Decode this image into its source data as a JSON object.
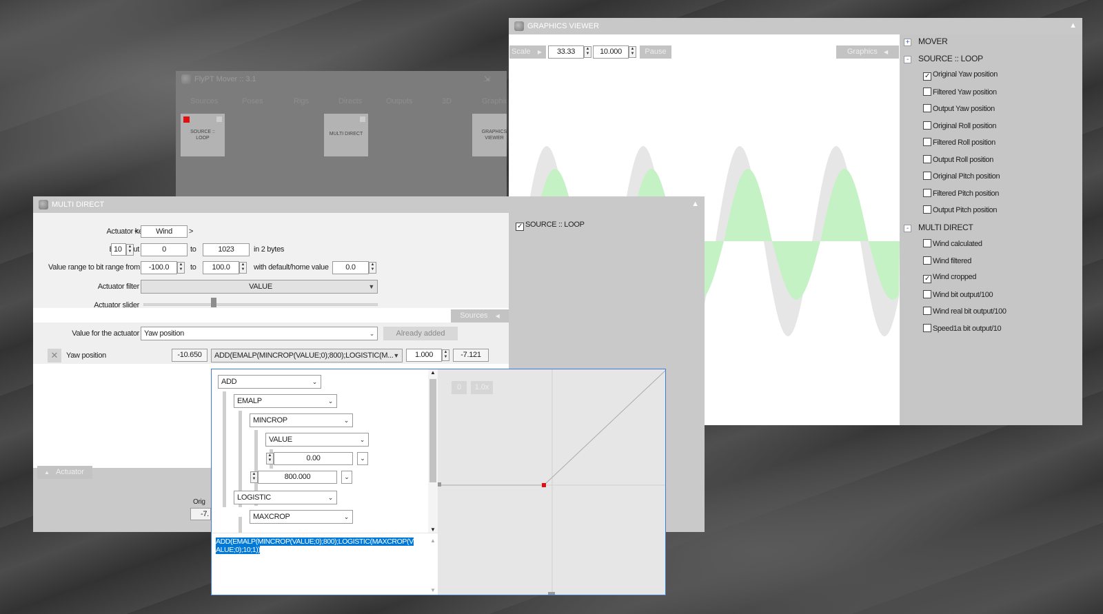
{
  "mover": {
    "title": "FlyPT Mover :: 3.1",
    "tabs": [
      "Sources",
      "Poses",
      "Rigs",
      "Directs",
      "Outputs",
      "3D",
      "Graphics"
    ],
    "tiles": [
      "SOURCE :: LOOP",
      "MULTI DIRECT",
      "GRAPHICS VIEWER"
    ]
  },
  "graphics": {
    "title": "GRAPHICS VIEWER",
    "scale_label": "Scale",
    "scale_value": "33.33",
    "second_value": "10.000",
    "pause_label": "Pause",
    "graphics_label": "Graphics",
    "legend": [
      {
        "kind": "head",
        "sign": "+",
        "label": "MOVER"
      },
      {
        "kind": "head",
        "sign": "-",
        "label": "SOURCE :: LOOP"
      },
      {
        "kind": "item",
        "checked": true,
        "label": "Original Yaw position"
      },
      {
        "kind": "item",
        "checked": false,
        "label": "Filtered Yaw position"
      },
      {
        "kind": "item",
        "checked": false,
        "label": "Output Yaw position"
      },
      {
        "kind": "item",
        "checked": false,
        "label": "Original Roll position"
      },
      {
        "kind": "item",
        "checked": false,
        "label": "Filtered Roll position"
      },
      {
        "kind": "item",
        "checked": false,
        "label": "Output Roll position"
      },
      {
        "kind": "item",
        "checked": false,
        "label": "Original Pitch position"
      },
      {
        "kind": "item",
        "checked": false,
        "label": "Filtered Pitch position"
      },
      {
        "kind": "item",
        "checked": false,
        "label": "Output Pitch position"
      },
      {
        "kind": "head",
        "sign": "-",
        "label": "MULTI DIRECT"
      },
      {
        "kind": "item",
        "checked": false,
        "label": "Wind calculated"
      },
      {
        "kind": "item",
        "checked": false,
        "label": "Wind filtered"
      },
      {
        "kind": "item",
        "checked": true,
        "label": "Wind cropped"
      },
      {
        "kind": "item",
        "checked": false,
        "label": "Wind bit output/100"
      },
      {
        "kind": "item",
        "checked": false,
        "label": "Wind real bit output/100"
      },
      {
        "kind": "item",
        "checked": false,
        "label": "Speed1a bit output/10"
      }
    ]
  },
  "multi": {
    "title": "MULTI DIRECT",
    "actuator_key_label": "Actuator key",
    "actuator_key_prev": "<",
    "actuator_key_value": "Wind",
    "actuator_key_next": ">",
    "bit_output_label": "Bit output",
    "bit_output_value": "10",
    "bit_from": "0",
    "to1": "to",
    "bit_to": "1023",
    "bytes_text": "in 2 bytes",
    "range_label": "Value range to bit range from",
    "range_from": "-100.0",
    "to2": "to",
    "range_to": "100.0",
    "default_label": "with default/home value",
    "default_value": "0.0",
    "filter_label": "Actuator filter",
    "filter_value": "VALUE",
    "slider_label": "Actuator slider",
    "slider_level": 0.3,
    "sources_btn": "Sources",
    "value_label": "Value for the actuator",
    "value_select": "Yaw position",
    "already_btn": "Already added",
    "row_name": "Yaw position",
    "row_value": "-10.650",
    "row_formula": "ADD(EMALP(MINCROP(VALUE;0);800);LOGISTIC(M...",
    "row_factor": "1.000",
    "row_result": "-7.121",
    "actuator_tab": "Actuator",
    "orig_text": "Orig",
    "orig_value": "-7.",
    "source_checkbox": "SOURCE :: LOOP"
  },
  "editor": {
    "tree": [
      {
        "label": "ADD",
        "kind": "dd"
      },
      {
        "label": "EMALP",
        "kind": "dd"
      },
      {
        "label": "MINCROP",
        "kind": "dd"
      },
      {
        "label": "VALUE",
        "kind": "dd"
      },
      {
        "label": "0.00",
        "kind": "num"
      },
      {
        "label": "800.000",
        "kind": "num"
      },
      {
        "label": "LOGISTIC",
        "kind": "dd"
      },
      {
        "label": "MAXCROP",
        "kind": "dd"
      }
    ],
    "formula": "ADD(EMALP(MINCROP(VALUE;0);800);LOGISTIC(MAXCROP(VALUE;0);10;1))",
    "btn0": "0",
    "btn1": "1.0x"
  }
}
